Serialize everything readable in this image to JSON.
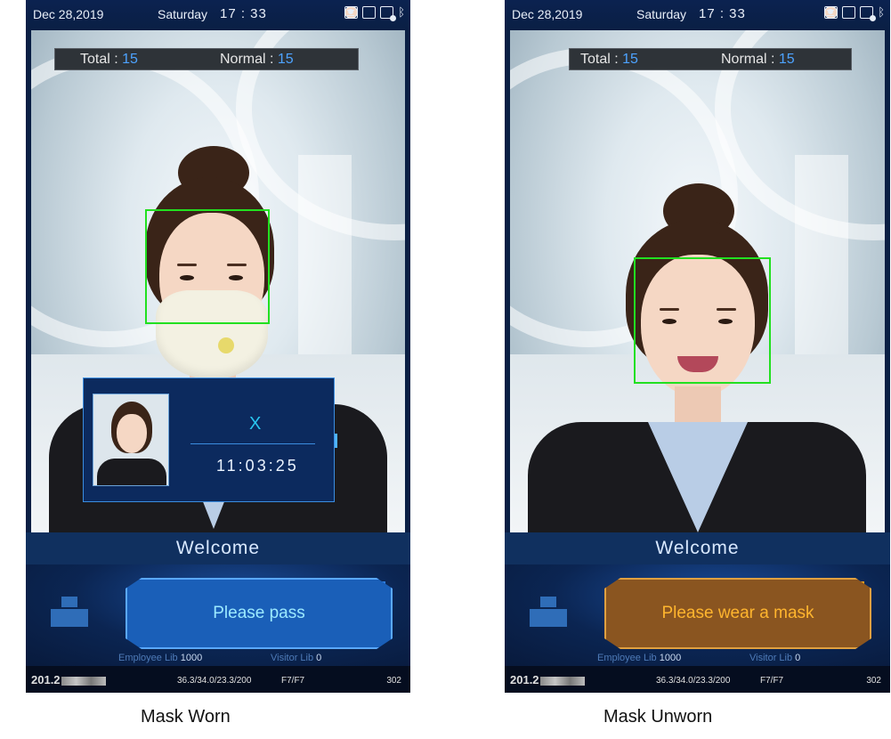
{
  "screens": [
    {
      "status": {
        "date": "Dec 28,2019",
        "weekday": "Saturday",
        "time": "17 : 33"
      },
      "counter": {
        "total_label": "Total :",
        "total_value": "15",
        "normal_label": "Normal :",
        "normal_value": "15"
      },
      "popup": {
        "status_mark": "X",
        "time": "11:03:25"
      },
      "welcome": "Welcome",
      "result": {
        "text": "Please pass",
        "color": "#1a5fb8"
      },
      "libs": {
        "employee_label": "Employee Lib",
        "employee_value": "1000",
        "visitor_label": "Visitor Lib",
        "visitor_value": "0"
      },
      "footer": {
        "ip": "201.2",
        "temps": "36.3/34.0/23.3/200",
        "floor": "F7/F7",
        "room": "302"
      },
      "caption": "Mask Worn"
    },
    {
      "status": {
        "date": "Dec 28,2019",
        "weekday": "Saturday",
        "time": "17 : 33"
      },
      "counter": {
        "total_label": "Total :",
        "total_value": "15",
        "normal_label": "Normal :",
        "normal_value": "15"
      },
      "welcome": "Welcome",
      "result": {
        "text": "Please wear a mask",
        "color": "#8a5520"
      },
      "libs": {
        "employee_label": "Employee Lib",
        "employee_value": "1000",
        "visitor_label": "Visitor Lib",
        "visitor_value": "0"
      },
      "footer": {
        "ip": "201.2",
        "temps": "36.3/34.0/23.3/200",
        "floor": "F7/F7",
        "room": "302"
      },
      "caption": "Mask Unworn"
    }
  ],
  "icons": [
    "face-recognition-icon",
    "id-card-icon",
    "document-icon",
    "document-info-icon",
    "bluetooth-icon"
  ],
  "colors": {
    "face_box": "#22e020",
    "accent_blue": "#4da3ff",
    "warn_text": "#ffb52e",
    "pass_text": "#9be9ff"
  }
}
